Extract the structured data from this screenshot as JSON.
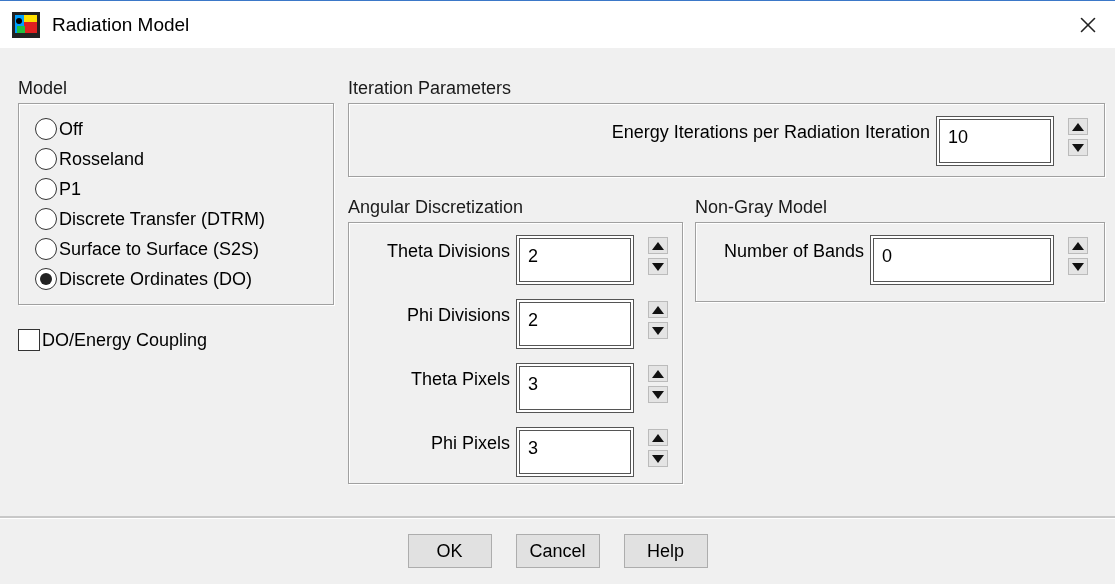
{
  "window": {
    "title": "Radiation Model"
  },
  "model": {
    "label": "Model",
    "options": [
      {
        "label": "Off",
        "selected": false
      },
      {
        "label": "Rosseland",
        "selected": false
      },
      {
        "label": "P1",
        "selected": false
      },
      {
        "label": "Discrete Transfer (DTRM)",
        "selected": false
      },
      {
        "label": "Surface to Surface (S2S)",
        "selected": false
      },
      {
        "label": "Discrete Ordinates (DO)",
        "selected": true
      }
    ]
  },
  "do_energy_coupling": {
    "label": "DO/Energy Coupling",
    "checked": false
  },
  "iteration_parameters": {
    "label": "Iteration Parameters",
    "fields": [
      {
        "label": "Energy Iterations per Radiation Iteration",
        "value": "10"
      }
    ]
  },
  "angular_discretization": {
    "label": "Angular Discretization",
    "fields": [
      {
        "label": "Theta Divisions",
        "value": "2"
      },
      {
        "label": "Phi Divisions",
        "value": "2"
      },
      {
        "label": "Theta Pixels",
        "value": "3"
      },
      {
        "label": "Phi Pixels",
        "value": "3"
      }
    ]
  },
  "non_gray_model": {
    "label": "Non-Gray Model",
    "fields": [
      {
        "label": "Number of Bands",
        "value": "0"
      }
    ]
  },
  "buttons": [
    "OK",
    "Cancel",
    "Help"
  ]
}
